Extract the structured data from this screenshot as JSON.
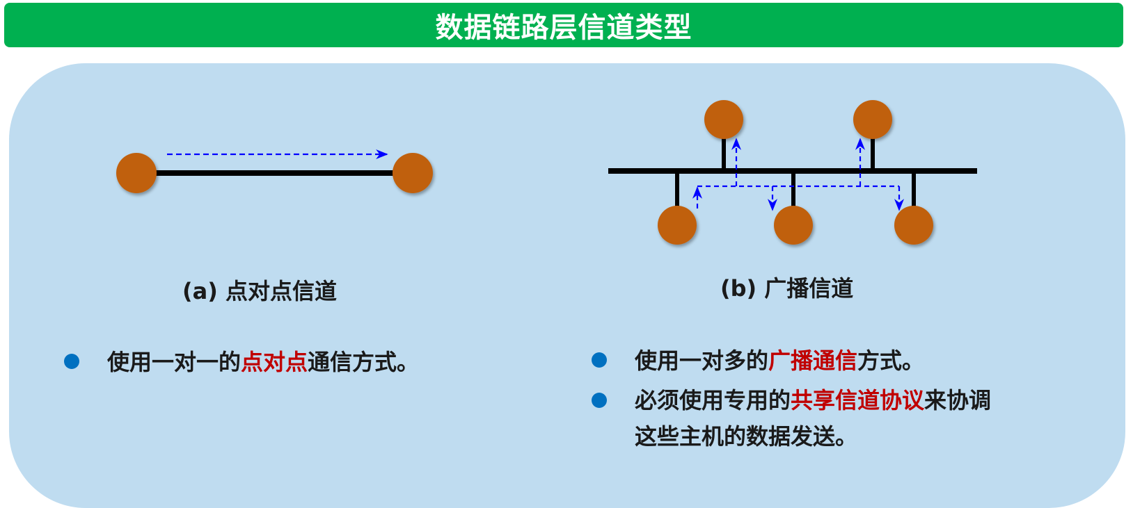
{
  "title": "数据链路层信道类型",
  "diagram_a": {
    "caption": "(a) 点对点信道"
  },
  "diagram_b": {
    "caption": "(b) 广播信道"
  },
  "left_bullets": [
    {
      "pre": "使用一对一的",
      "highlight": "点对点",
      "post": "通信方式。"
    }
  ],
  "right_bullets": [
    {
      "pre": "使用一对多的",
      "highlight": "广播通信",
      "post": "方式。"
    },
    {
      "pre": "必须使用专用的",
      "highlight": "共享信道协议",
      "post": "来协调这些主机的数据发送。"
    }
  ],
  "colors": {
    "title_bar": "#00b050",
    "panel": "#bfdcf0",
    "node": "#c0600a",
    "link": "#000000",
    "signal_arrow": "#0000ff",
    "highlight": "#c00000",
    "bullet_dot": "#0070c0"
  }
}
